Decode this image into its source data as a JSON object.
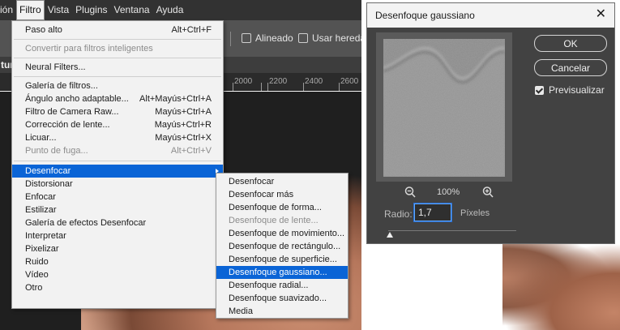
{
  "menubar": {
    "items": [
      "ión",
      "Filtro",
      "Vista",
      "Plugins",
      "Ventana",
      "Ayuda"
    ]
  },
  "options_bar": {
    "aligned_label": "Alineado",
    "sample_label": "Usar hereda"
  },
  "document": {
    "tab_label": "tur"
  },
  "ruler": {
    "labels": [
      "2000",
      "2200",
      "2400",
      "2600"
    ]
  },
  "filter_menu": {
    "items": [
      {
        "label": "Paso alto",
        "shortcut": "Alt+Ctrl+F",
        "disabled": false
      },
      {
        "label": "Convertir para filtros inteligentes",
        "disabled": true
      },
      {
        "label": "Neural Filters...",
        "disabled": false
      },
      {
        "label": "Galería de filtros...",
        "disabled": false
      },
      {
        "label": "Ángulo ancho adaptable...",
        "shortcut": "Alt+Mayús+Ctrl+A",
        "disabled": false
      },
      {
        "label": "Filtro de Camera Raw...",
        "shortcut": "Mayús+Ctrl+A",
        "disabled": false
      },
      {
        "label": "Corrección de lente...",
        "shortcut": "Mayús+Ctrl+R",
        "disabled": false
      },
      {
        "label": "Licuar...",
        "shortcut": "Mayús+Ctrl+X",
        "disabled": false
      },
      {
        "label": "Punto de fuga...",
        "shortcut": "Alt+Ctrl+V",
        "disabled": true
      },
      {
        "label": "Desenfocar",
        "submenu": true,
        "highlighted": true
      },
      {
        "label": "Distorsionar",
        "submenu": true
      },
      {
        "label": "Enfocar",
        "submenu": true
      },
      {
        "label": "Estilizar",
        "submenu": true
      },
      {
        "label": "Galería de efectos Desenfocar",
        "submenu": true
      },
      {
        "label": "Interpretar",
        "submenu": true
      },
      {
        "label": "Pixelizar",
        "submenu": true
      },
      {
        "label": "Ruido",
        "submenu": true
      },
      {
        "label": "Vídeo",
        "submenu": true
      },
      {
        "label": "Otro",
        "submenu": true
      }
    ]
  },
  "blur_submenu": {
    "items": [
      {
        "label": "Desenfocar",
        "disabled": false
      },
      {
        "label": "Desenfocar más",
        "disabled": false
      },
      {
        "label": "Desenfoque de forma...",
        "disabled": false
      },
      {
        "label": "Desenfoque de lente...",
        "disabled": true
      },
      {
        "label": "Desenfoque de movimiento...",
        "disabled": false
      },
      {
        "label": "Desenfoque de rectángulo...",
        "disabled": false
      },
      {
        "label": "Desenfoque de superficie...",
        "disabled": false
      },
      {
        "label": "Desenfoque gaussiano...",
        "disabled": false,
        "highlighted": true
      },
      {
        "label": "Desenfoque radial...",
        "disabled": false
      },
      {
        "label": "Desenfoque suavizado...",
        "disabled": false
      },
      {
        "label": "Media",
        "disabled": false
      }
    ]
  },
  "dialog": {
    "title": "Desenfoque gaussiano",
    "close_glyph": "✕",
    "ok_label": "OK",
    "cancel_label": "Cancelar",
    "preview_label": "Previsualizar",
    "preview_checked": true,
    "zoom_level": "100%",
    "radius_label": "Radio:",
    "radius_value": "1,7",
    "radius_unit": "Píxeles",
    "radius_slider_fraction": 0.01
  },
  "colors": {
    "menu_highlight": "#0a64d6",
    "dialog_bg": "#424242",
    "ps_menubar": "#323232"
  }
}
